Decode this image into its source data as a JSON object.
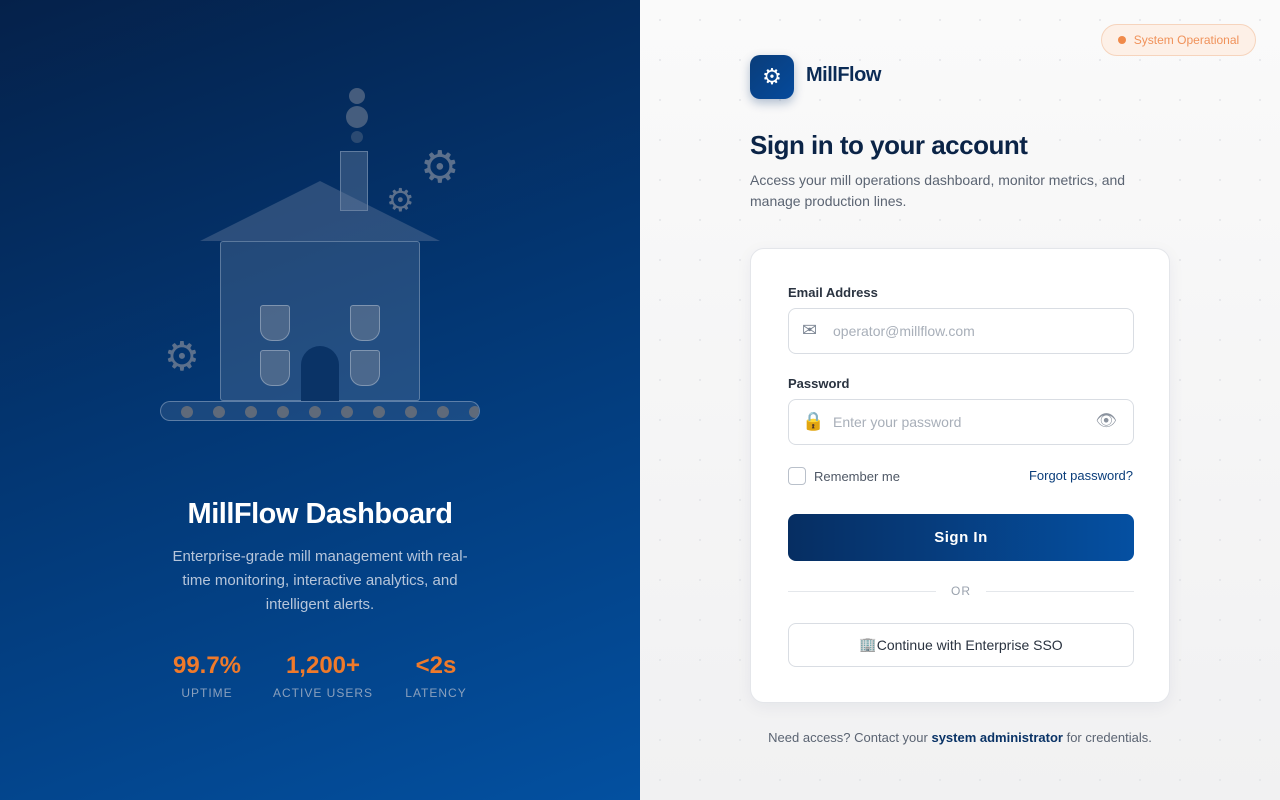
{
  "hero": {
    "title": "MillFlow Dashboard",
    "subtitle": "Enterprise-grade mill management with real-time monitoring, interactive analytics, and intelligent alerts.",
    "stats": [
      {
        "value": "99.7%",
        "label": "UPTIME"
      },
      {
        "value": "1,200+",
        "label": "ACTIVE USERS"
      },
      {
        "value": "<2s",
        "label": "LATENCY"
      }
    ]
  },
  "status": {
    "label": "System Operational",
    "color": "#f08a4a"
  },
  "brand": {
    "name": "MillFlow",
    "icon": "gear-icon",
    "color": "#0a3d7a"
  },
  "login": {
    "heading": "Sign in to your account",
    "subheading": "Access your mill operations dashboard, monitor metrics, and manage production lines.",
    "email_label": "Email Address",
    "email_placeholder": "operator@millflow.com",
    "email_value": "",
    "password_label": "Password",
    "password_placeholder": "Enter your password",
    "password_value": "",
    "remember_label": "Remember me",
    "remember_checked": false,
    "forgot_label": "Forgot password?",
    "signin_label": "Sign In",
    "or_label": "OR",
    "sso_label": "Continue with Enterprise SSO"
  },
  "footer": {
    "prefix": "Need access? Contact your ",
    "link": "system administrator",
    "suffix": " for credentials."
  },
  "icons": {
    "email": "envelope-icon",
    "password": "lock-icon",
    "toggle": "eye-icon",
    "sso": "building-icon"
  },
  "colors": {
    "accent": "#f07a2a",
    "primary": "#0550a2",
    "hero_bg": "#033672"
  }
}
